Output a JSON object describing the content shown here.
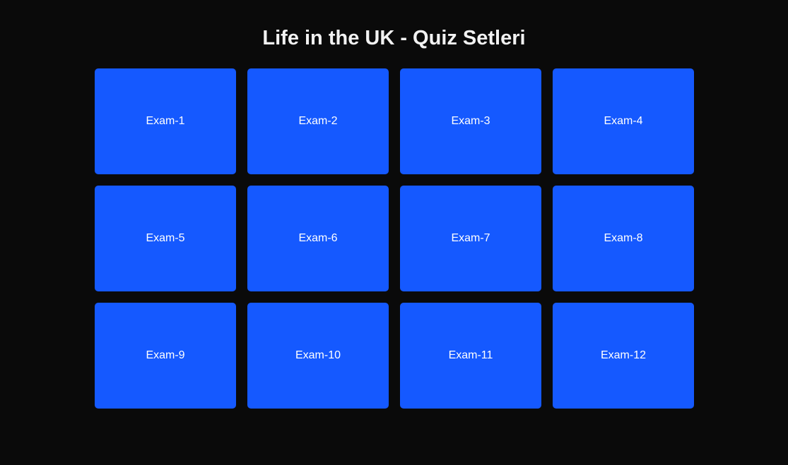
{
  "page": {
    "title": "Life in the UK - Quiz Setleri"
  },
  "colors": {
    "background": "#0a0a0a",
    "card": "#1559ff",
    "text": "#ffffff"
  },
  "exams": [
    {
      "label": "Exam-1"
    },
    {
      "label": "Exam-2"
    },
    {
      "label": "Exam-3"
    },
    {
      "label": "Exam-4"
    },
    {
      "label": "Exam-5"
    },
    {
      "label": "Exam-6"
    },
    {
      "label": "Exam-7"
    },
    {
      "label": "Exam-8"
    },
    {
      "label": "Exam-9"
    },
    {
      "label": "Exam-10"
    },
    {
      "label": "Exam-11"
    },
    {
      "label": "Exam-12"
    }
  ]
}
